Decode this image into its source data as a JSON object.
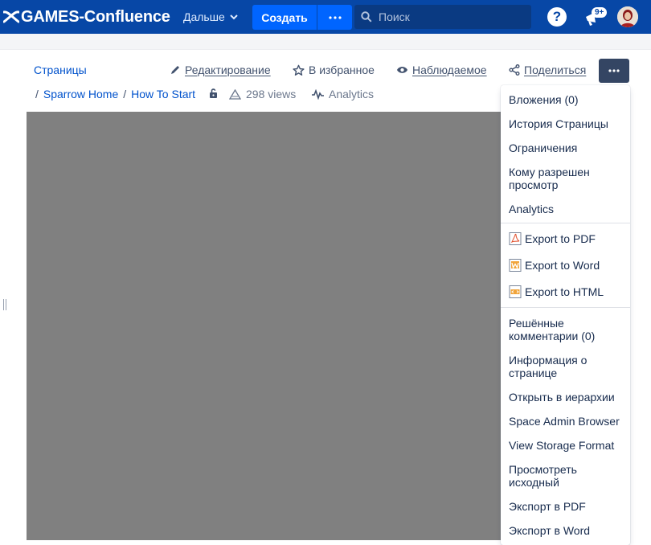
{
  "topnav": {
    "logo_text": "GAMES-Confluence",
    "more_label": "Дальше",
    "create_label": "Создать",
    "create_more_label": "•••",
    "search_placeholder": "Поиск",
    "help_label": "?",
    "notifications_badge": "9+"
  },
  "toolbar": {
    "pages_link": "Страницы",
    "edit_label": "Редактирование",
    "favorite_label": "В избранное",
    "watch_label": "Наблюдаемое",
    "share_label": "Поделиться",
    "more_label": "•••"
  },
  "breadcrumbs": [
    {
      "label": "Sparrow Home"
    },
    {
      "label": "How To Start"
    }
  ],
  "meta": {
    "views": "298 views",
    "analytics": "Analytics"
  },
  "dropdown": {
    "group1": [
      {
        "label": "Вложения (0)"
      },
      {
        "label": "История Страницы"
      },
      {
        "label": "Ограничения"
      },
      {
        "label": "Кому разрешен просмотр"
      },
      {
        "label": "Analytics"
      }
    ],
    "group2": [
      {
        "label": "Export to PDF",
        "icon": "pdf-file-icon"
      },
      {
        "label": "Export to Word",
        "icon": "word-file-icon"
      },
      {
        "label": "Export to HTML",
        "icon": "html-file-icon"
      }
    ],
    "group3": [
      {
        "label": "Решённые комментарии (0)"
      },
      {
        "label": "Информация о странице"
      },
      {
        "label": "Открыть в иерархии"
      },
      {
        "label": "Space Admin Browser"
      },
      {
        "label": "View Storage Format"
      },
      {
        "label": "Просмотреть исходный"
      },
      {
        "label": "Экспорт в PDF"
      },
      {
        "label": "Экспорт в Word"
      }
    ]
  },
  "colors": {
    "nav_bg": "#0747a6",
    "primary": "#0065ff",
    "link": "#0052cc",
    "content_placeholder": "#808080"
  }
}
